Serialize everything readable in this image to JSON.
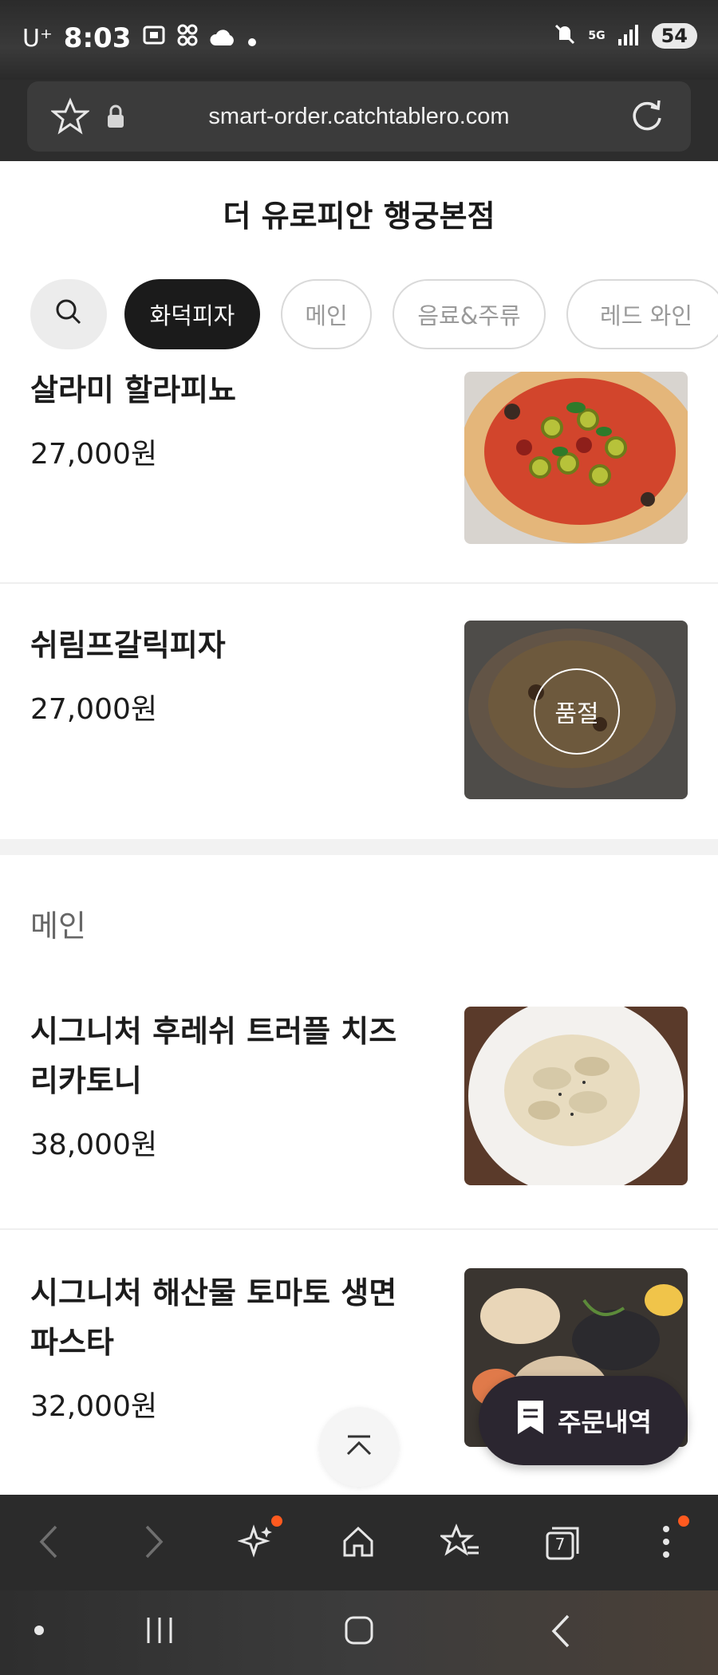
{
  "status_bar": {
    "carrier": "U⁺",
    "time": "8:03",
    "battery": "54",
    "network": "5G"
  },
  "browser": {
    "url": "smart-order.catchtablero.com",
    "tabs_count": "7"
  },
  "store": {
    "title": "더 유로피안 행궁본점"
  },
  "categories": [
    {
      "label": "화덕피자",
      "active": true
    },
    {
      "label": "메인",
      "active": false
    },
    {
      "label": "음료&주류",
      "active": false
    },
    {
      "label": "레드 와인",
      "active": false
    }
  ],
  "menu": {
    "items": [
      {
        "name": "살라미 할라피뇨",
        "price": "27,000원",
        "image": "salami-jalapeno-pizza"
      },
      {
        "name": "쉬림프갈릭피자",
        "price": "27,000원",
        "image": "shrimp-garlic-pizza",
        "badge": "품절"
      }
    ],
    "section_main": {
      "label": "메인",
      "items": [
        {
          "name_line1": "시그니처 후레쉬 트러플 치즈",
          "name_line2": "리카토니",
          "price": "38,000원",
          "image": "truffle-rigatoni"
        },
        {
          "name_line1": "시그니처 해산물 토마토 생면",
          "name_line2": "파스타",
          "price": "32,000원",
          "image": "seafood-pasta"
        }
      ]
    }
  },
  "floating": {
    "order_history_label": "주문내역"
  },
  "colors": {
    "accent_chip": "#1b1b1b",
    "order_button": "#2b2630",
    "badge_orange": "#ff5a1f"
  }
}
